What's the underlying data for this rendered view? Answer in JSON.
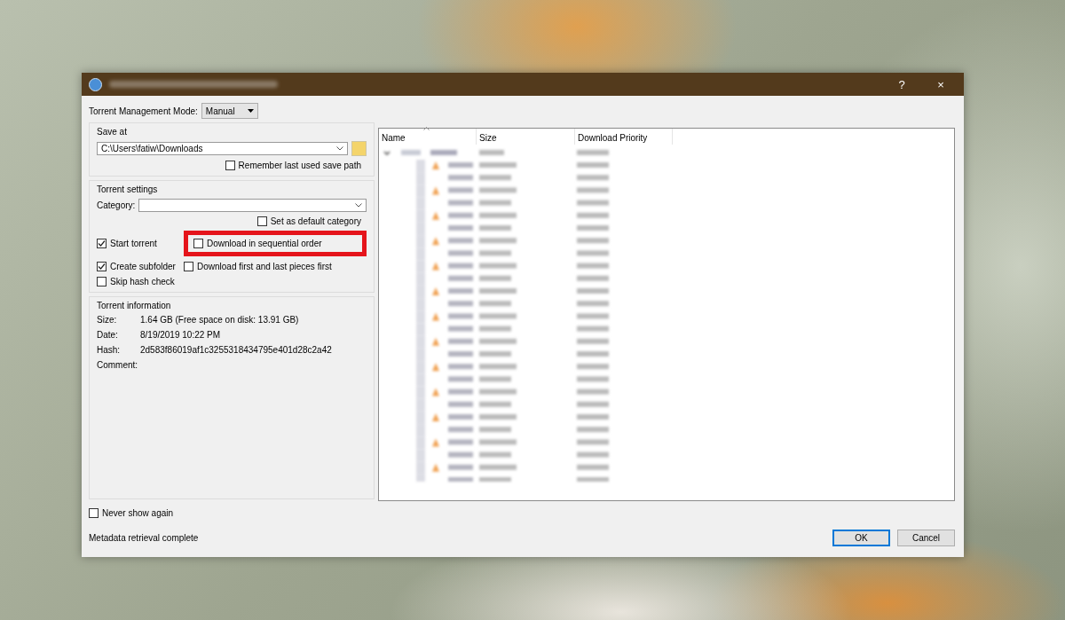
{
  "window": {
    "help_button": "?",
    "close_button": "×"
  },
  "management_mode": {
    "label": "Torrent Management Mode:",
    "value": "Manual"
  },
  "save_at": {
    "title": "Save at",
    "path": "C:\\Users\\fatiw\\Downloads",
    "remember": {
      "label": "Remember last used save path",
      "checked": false
    }
  },
  "torrent_settings": {
    "title": "Torrent settings",
    "category_label": "Category:",
    "default_category": {
      "label": "Set as default category",
      "checked": false
    },
    "options": [
      {
        "label": "Start torrent",
        "checked": true,
        "highlighted": false
      },
      {
        "label": "Download in sequential order",
        "checked": false,
        "highlighted": true
      },
      {
        "label": "Create subfolder",
        "checked": true,
        "highlighted": false
      },
      {
        "label": "Download first and last pieces first",
        "checked": false,
        "highlighted": false
      },
      {
        "label": "Skip hash check",
        "checked": false,
        "highlighted": false
      }
    ]
  },
  "torrent_information": {
    "title": "Torrent information",
    "fields": [
      {
        "label": "Size:",
        "value": "1.64 GB (Free space on disk: 13.91 GB)"
      },
      {
        "label": "Date:",
        "value": "8/19/2019 10:22 PM"
      },
      {
        "label": "Hash:",
        "value": "2d583f86019af1c3255318434795e401d28c2a42"
      },
      {
        "label": "Comment:"
      }
    ]
  },
  "file_list": {
    "columns": [
      "Name",
      "Size",
      "Download Priority"
    ]
  },
  "never_show": {
    "label": "Never show again",
    "checked": false
  },
  "status": "Metadata retrieval complete",
  "buttons": [
    {
      "label": "OK",
      "default": true
    },
    {
      "label": "Cancel",
      "default": false
    }
  ]
}
